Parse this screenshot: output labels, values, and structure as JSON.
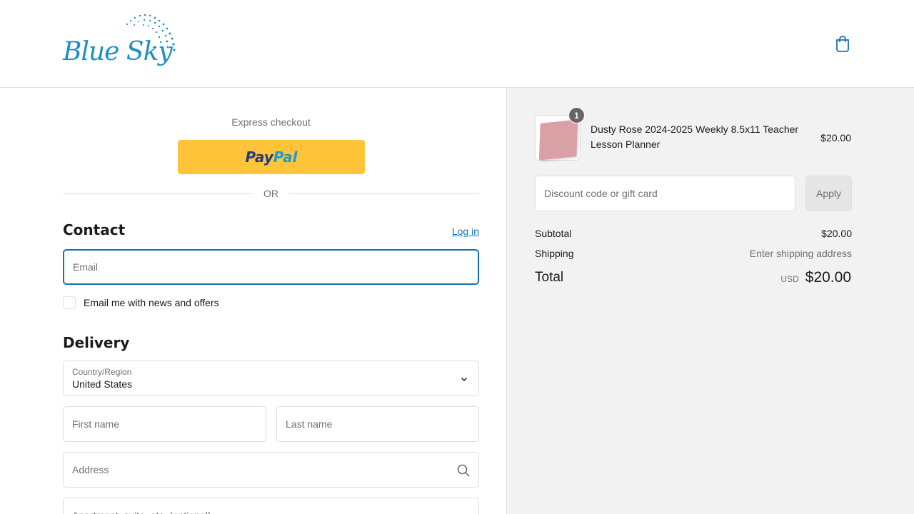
{
  "header": {
    "logo_text": "Blue Sky",
    "cart_icon": "shopping-bag-icon"
  },
  "express": {
    "label": "Express checkout",
    "paypal_pay": "Pay",
    "paypal_pal": "Pal",
    "or_text": "OR"
  },
  "contact": {
    "title": "Contact",
    "login_label": "Log in",
    "email_placeholder": "Email",
    "newsletter_label": "Email me with news and offers"
  },
  "delivery": {
    "title": "Delivery",
    "country_label": "Country/Region",
    "country_value": "United States",
    "first_name_placeholder": "First name",
    "last_name_placeholder": "Last name",
    "address_placeholder": "Address",
    "apartment_placeholder": "Apartment, suite, etc. (optional)"
  },
  "summary": {
    "item": {
      "quantity": "1",
      "name": "Dusty Rose 2024-2025 Weekly 8.5x11 Teacher Lesson Planner",
      "price": "$20.00"
    },
    "discount_placeholder": "Discount code or gift card",
    "apply_label": "Apply",
    "subtotal_label": "Subtotal",
    "subtotal_value": "$20.00",
    "shipping_label": "Shipping",
    "shipping_value": "Enter shipping address",
    "total_label": "Total",
    "currency": "USD",
    "total_value": "$20.00"
  },
  "colors": {
    "accent": "#1773b0",
    "brand": "#1d8fc7",
    "paypal_yellow": "#ffc439",
    "sidebar_bg": "#f2f2f2"
  }
}
